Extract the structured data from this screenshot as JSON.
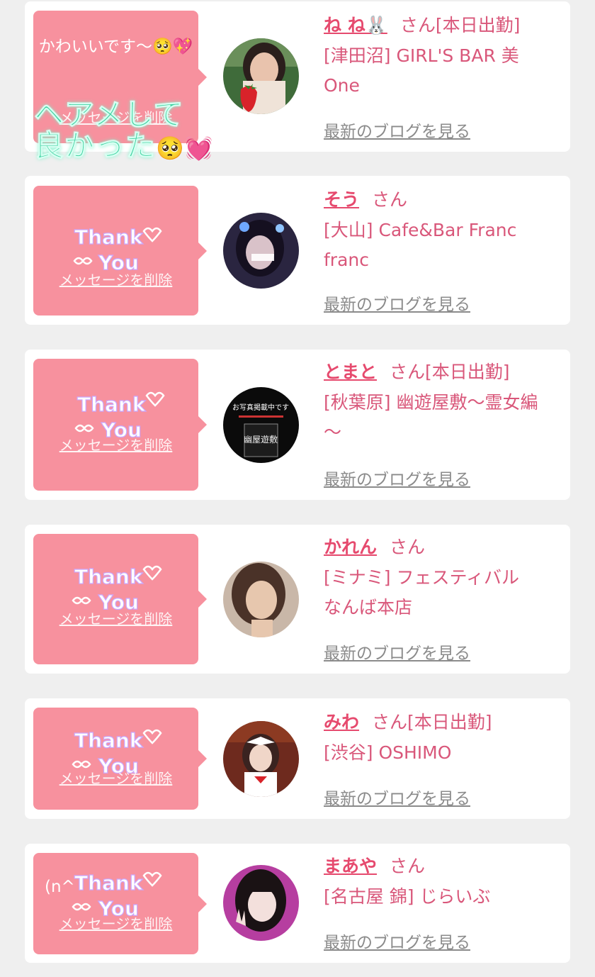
{
  "common": {
    "delete_label": "メッセージを削除",
    "blog_label": "最新のブログを見る",
    "stamp_line1": "Thank",
    "stamp_line2": "You"
  },
  "colors": {
    "background": "#efefef",
    "bubble": "#f7919e",
    "name": "#e64a6e",
    "shop": "#d9577a",
    "blog_link": "#8b8b8b",
    "overlay_text": "#3fd1a0"
  },
  "overlay": {
    "line1": "ヘアメして",
    "line2": "良かった",
    "emojis": "🥺💓"
  },
  "entries": [
    {
      "name": "ね ね🐰",
      "san": "さん[本日出勤]",
      "shop_line1": "[津田沼] GIRL'S BAR 美",
      "shop_line2": "One",
      "message": "かわいいです〜🥺💖",
      "avatar_icon": "strawberry-photo-icon"
    },
    {
      "name": "そう",
      "san": "さん",
      "shop_line1": "[大山] Cafe&Bar Franc",
      "shop_line2": "franc",
      "message": "",
      "avatar_icon": "girl-photo-icon"
    },
    {
      "name": "とまと",
      "san": "さん[本日出勤]",
      "shop_line1": "[秋葉原] 幽遊屋敷〜霊女編",
      "shop_line2": "〜",
      "message": "",
      "avatar_icon": "shop-sign-icon",
      "avatar_text_top": "お写真掲載中です",
      "avatar_text_main": "幽屋遊敷"
    },
    {
      "name": "かれん",
      "san": "さん",
      "shop_line1": "[ミナミ] フェスティバル",
      "shop_line2": "なんば本店",
      "message": "",
      "avatar_icon": "girl-photo-icon"
    },
    {
      "name": "みわ",
      "san": "さん[本日出勤]",
      "shop_line1": "[渋谷] OSHIMO",
      "shop_line2": "",
      "message": "",
      "avatar_icon": "maid-photo-icon"
    },
    {
      "name": "まあや",
      "san": "さん",
      "shop_line1": "[名古屋 錦] じらいぶ",
      "shop_line2": "",
      "message": "(n^",
      "avatar_icon": "girl-peace-photo-icon"
    }
  ]
}
